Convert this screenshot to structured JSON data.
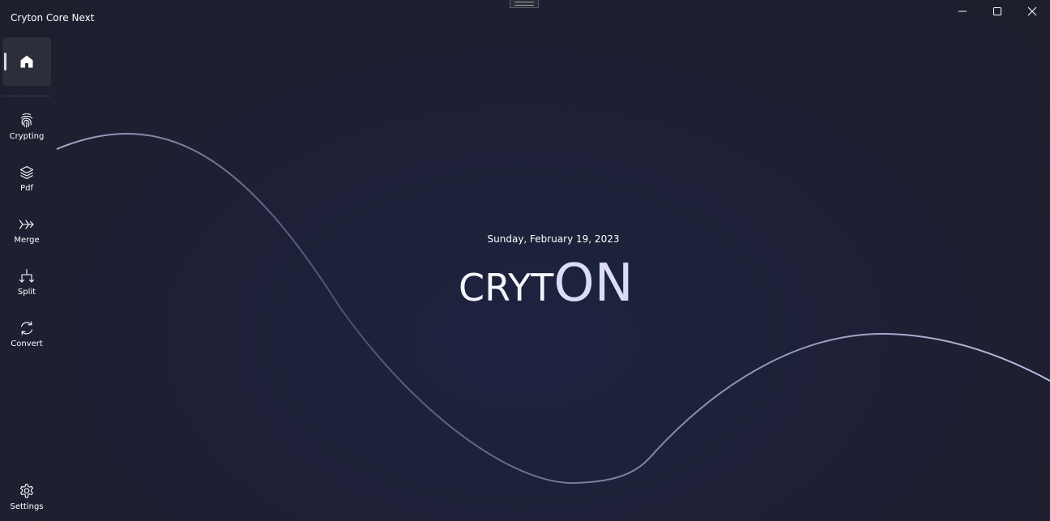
{
  "window": {
    "title": "Cryton Core Next"
  },
  "nav": {
    "home": {
      "icon": "home-icon",
      "selected": true
    },
    "items": [
      {
        "label": "Crypting",
        "icon": "fingerprint-icon"
      },
      {
        "label": "Pdf",
        "icon": "layers-icon"
      },
      {
        "label": "Merge",
        "icon": "merge-icon"
      },
      {
        "label": "Split",
        "icon": "split-icon"
      },
      {
        "label": "Convert",
        "icon": "sync-icon"
      }
    ],
    "settings": {
      "label": "Settings",
      "icon": "gear-icon"
    }
  },
  "main": {
    "date": "Sunday, February 19, 2023",
    "logo_part1": "CRYT",
    "logo_part2": "ON"
  },
  "colors": {
    "background": "#1d2036",
    "accent": "#dcdcf4",
    "wave": "#b8bade"
  }
}
